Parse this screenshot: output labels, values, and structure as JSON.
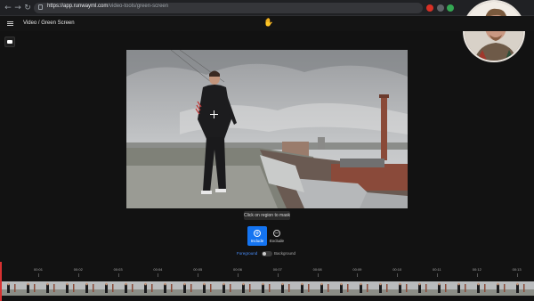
{
  "browser": {
    "url_host": "https://app.runwayml.com",
    "url_path": "/video-tools/green-screen"
  },
  "header": {
    "breadcrumb": "Video / Green Screen"
  },
  "tooltip": "Click on region to mask",
  "mask_modes": [
    {
      "label": "Include",
      "icon": "plus-circle-icon",
      "active": true
    },
    {
      "label": "Exclude",
      "icon": "minus-circle-icon",
      "active": false
    }
  ],
  "toggle": {
    "left_label": "Foreground",
    "right_label": "Background"
  },
  "timeline": {
    "ticks": [
      "00:01",
      "00:02",
      "00:03",
      "00:04",
      "00:05",
      "00:06",
      "00:07",
      "00:08",
      "00:09",
      "00:10",
      "00:11",
      "00:12",
      "00:13"
    ]
  },
  "colors": {
    "accent": "#1474f1",
    "playhead": "#d63131",
    "background": "#121212"
  }
}
